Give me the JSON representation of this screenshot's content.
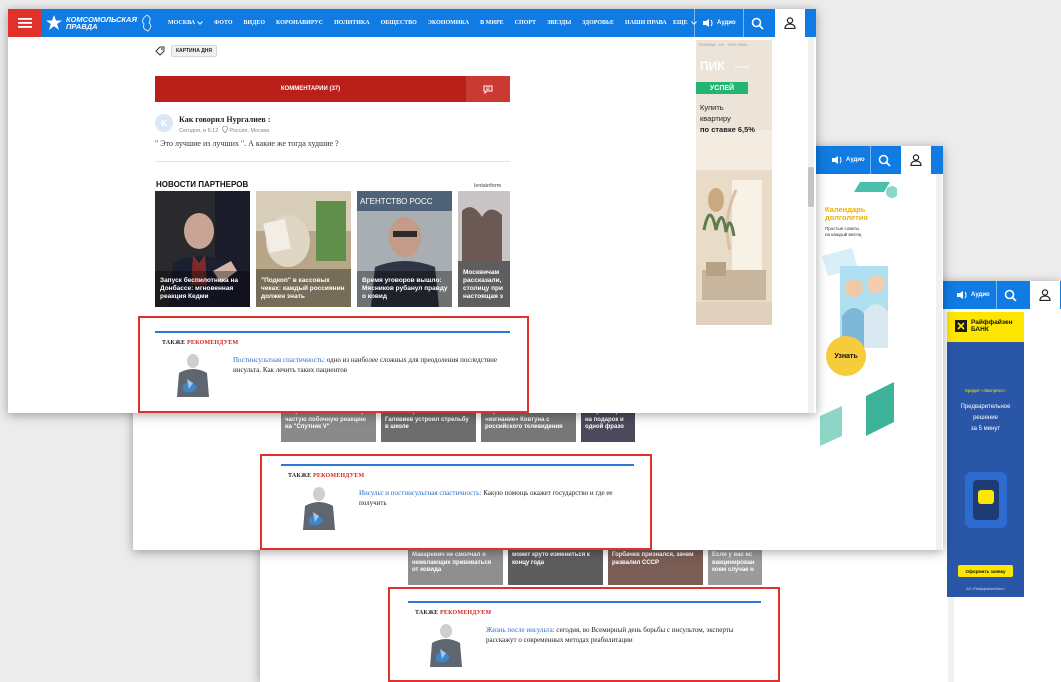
{
  "colors": {
    "nav_blue": "#0f7be3",
    "accent_red": "#e0312a",
    "button_red": "#bb1f19",
    "link_blue": "#2b6ec7"
  },
  "nav": {
    "logo_line1": "Комсомольская",
    "logo_line2": "правда",
    "region": "Москва",
    "menu": [
      "Фото",
      "Видео",
      "Коронавирус",
      "Политика",
      "Общество",
      "Экономика",
      "В мире",
      "Спорт",
      "Звезды",
      "Здоровье",
      "Наши права"
    ],
    "more": "Еще",
    "audio": "Аудио"
  },
  "tag": {
    "label": "КАРТИНА ДНЯ"
  },
  "comments": {
    "label": "КОММЕНТАРИИ (37)"
  },
  "comment": {
    "avatar": "K",
    "author": "Как говорил Нургалиев :",
    "time": "Сегодня, в 6:12",
    "location": "Россия, Москва",
    "text": "\" Это лучшие из лучших \". А какие же тогда худшие ?"
  },
  "partners": {
    "title": "НОВОСТИ ПАРТНЕРОВ",
    "source": "lentainform",
    "cards": [
      "Запуск беспилотника на Донбассе: мгновенная реакция Кедми",
      "\"Подкоп\" в кассовых чеках: каждый россиянин должен знать",
      "Время уговоров вышло: Мясников рубанул правду о ковид",
      "Москвичам рассказали, столицу при настоящая з"
    ],
    "card3_overlay": "АГЕНТСТВО РОСС"
  },
  "row2": [
    "В Аргентине назвали самую частую побочную реакцию на \"Спутник V\"",
    "Вот и вскрылось: из-за чего Галявиев устроил стрельбу в школе",
    "Норкин объяснил «изгнание» Ковтуна с российского телевидения",
    "Лавров отре на подарок и одной фразо"
  ],
  "row3": [
    "Макаревич не смолчал о нежелающих прививаться от ковида",
    "может круто измениться к концу года",
    "Горбачев признался, зачем развалил СССР",
    "Если у вас ес вакцинирован коем случае н"
  ],
  "recommend": {
    "head1": "ТАКЖЕ ",
    "head2": "РЕКОМЕНДУЕМ",
    "items": [
      {
        "link": "Постинсультная спастичность:",
        "text": " одно из наиболее сложных для преодоления последствие инсульта. Как лечить таких пациентов"
      },
      {
        "link": "Инсульт и постинсультная спастичность:",
        "text": " Какую помощь окажет государство и где ее получить"
      },
      {
        "link": "Жизнь после инсульта:",
        "text": " сегодня, во Всемирный день борьбы с инсультом, эксперты расскажут о современных методах реабилитации"
      }
    ]
  },
  "ad_pik": {
    "disclaimer": "РЕКЛАМА · 16+ · ООО «ПИК»",
    "brand": "ПИК",
    "brand_sub": "Ипотека",
    "badge": "УСПЕЙ",
    "line1": "Купить",
    "line2": "квартиру",
    "line3": "по ставке 6,5%"
  },
  "ad_health": {
    "title1": "Календарь",
    "title2": "долголетия",
    "sub1": "Простые советы",
    "sub2": "на каждый месяц",
    "cta": "Узнать"
  },
  "ad_bank": {
    "brand1": "Райффайзен",
    "brand2": "БАНК",
    "product": "Кредит «Экспресс»",
    "l1": "Предварительное",
    "l2": "решение",
    "l3": "за 5 минут",
    "cta": "Оформить заявку",
    "footer": "АО «Райффайзенбанк»"
  }
}
